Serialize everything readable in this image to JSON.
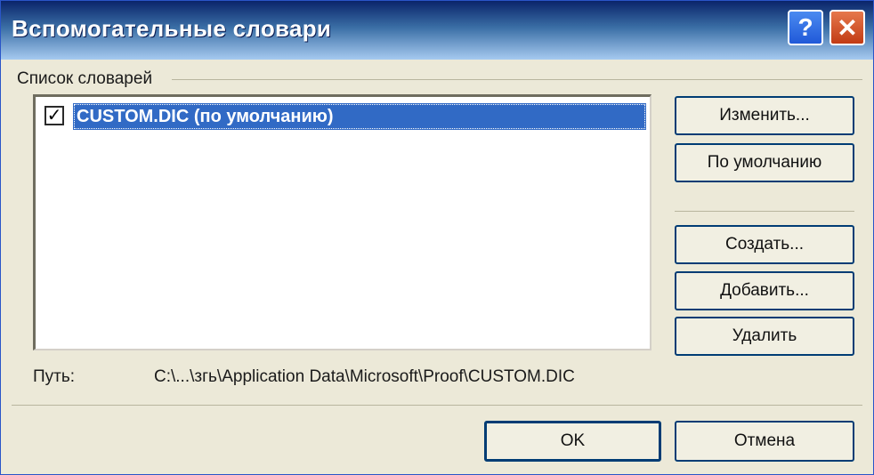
{
  "window": {
    "title": "Вспомогательные словари"
  },
  "titlebar_buttons": {
    "help": "?",
    "close": "✕"
  },
  "group": {
    "label": "Список словарей"
  },
  "list": {
    "items": [
      {
        "label": "CUSTOM.DIC (по умолчанию)",
        "checked": true,
        "selected": true
      }
    ]
  },
  "buttons": {
    "edit": "Изменить...",
    "default": "По умолчанию",
    "create": "Создать...",
    "add": "Добавить...",
    "remove": "Удалить",
    "ok": "OK",
    "cancel": "Отмена"
  },
  "path": {
    "label": "Путь:",
    "value": "C:\\...\\згь\\Application Data\\Microsoft\\Proof\\CUSTOM.DIC"
  }
}
